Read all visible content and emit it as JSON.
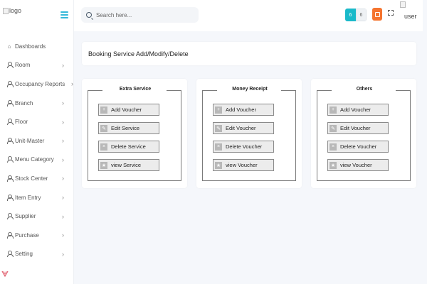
{
  "logo_alt": "logo",
  "search": {
    "placeholder": "Search here..."
  },
  "header": {
    "user_alt": "user",
    "toggle_left": "6",
    "toggle_right": "6"
  },
  "colors": {
    "accent": "#1ab9c9",
    "orange": "#f5742f",
    "hamburger": "#35b8d9"
  },
  "sidebar": {
    "items": [
      {
        "label": "Dashboards",
        "icon": "home-icon",
        "chevron": false
      },
      {
        "label": "Room",
        "icon": "person-icon",
        "chevron": true
      },
      {
        "label": "Occupancy Reports",
        "icon": "person-icon",
        "chevron": true
      },
      {
        "label": "Branch",
        "icon": "person-icon",
        "chevron": true
      },
      {
        "label": "Floor",
        "icon": "person-icon",
        "chevron": true
      },
      {
        "label": "Unit-Master",
        "icon": "person-icon",
        "chevron": true
      },
      {
        "label": "Menu Category",
        "icon": "person-icon",
        "chevron": true
      },
      {
        "label": "Stock Center",
        "icon": "person-icon",
        "chevron": true
      },
      {
        "label": "Item Entry",
        "icon": "person-icon",
        "chevron": true
      },
      {
        "label": "Supplier",
        "icon": "person-icon",
        "chevron": true
      },
      {
        "label": "Purchase",
        "icon": "person-icon",
        "chevron": true
      },
      {
        "label": "Setting",
        "icon": "person-icon",
        "chevron": true
      }
    ]
  },
  "main": {
    "title": "Booking Service Add/Modify/Delete",
    "panels": [
      {
        "legend": "Extra Service",
        "buttons": [
          {
            "label": "Add Voucher",
            "icon": "plus-icon"
          },
          {
            "label": "Edit Service",
            "icon": "edit-icon"
          },
          {
            "label": "Delete Service",
            "icon": "close-icon"
          },
          {
            "label": "view Service",
            "icon": "star-icon"
          }
        ]
      },
      {
        "legend": "Money Receipt",
        "buttons": [
          {
            "label": "Add Voucher",
            "icon": "plus-icon"
          },
          {
            "label": "Edit Voucher",
            "icon": "edit-icon"
          },
          {
            "label": "Delete Voucher",
            "icon": "close-icon"
          },
          {
            "label": "view Voucher",
            "icon": "star-icon"
          }
        ]
      },
      {
        "legend": "Others",
        "buttons": [
          {
            "label": "Add Voucher",
            "icon": "plus-icon"
          },
          {
            "label": "Edit Voucher",
            "icon": "edit-icon"
          },
          {
            "label": "Delete Voucher",
            "icon": "close-icon"
          },
          {
            "label": "view Voucher",
            "icon": "star-icon"
          }
        ]
      }
    ]
  }
}
